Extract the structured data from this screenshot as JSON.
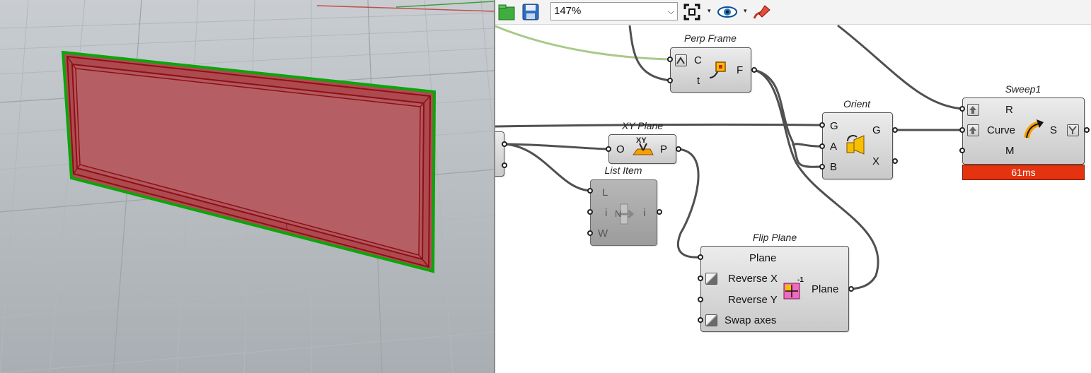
{
  "toolbar": {
    "zoom_value": "147%",
    "icons": [
      "open-file-icon",
      "save-file-icon",
      "zoom-extents-icon",
      "preview-eye-icon",
      "sketch-pen-icon"
    ]
  },
  "viewport": {
    "colors": {
      "fill": "#b55459",
      "edge": "#8e0f15",
      "selection": "#0aa60a",
      "background": "#b4b8bc"
    }
  },
  "components": {
    "perp_frame": {
      "title": "Perp Frame",
      "inputs": [
        "C",
        "t"
      ],
      "outputs": [
        "F"
      ]
    },
    "orient": {
      "title": "Orient",
      "inputs": [
        "G",
        "A",
        "B"
      ],
      "outputs": [
        "G",
        "X"
      ]
    },
    "sweep1": {
      "title": "Sweep1",
      "inputs": [
        "R",
        "Curve",
        "M"
      ],
      "outputs": [
        "S"
      ],
      "timing": "61ms"
    },
    "xy_plane": {
      "title": "XY Plane",
      "inputs": [
        "O"
      ],
      "outputs": [
        "P"
      ],
      "icon_text": "XY"
    },
    "list_item": {
      "title": "List Item",
      "inputs": [
        "L",
        "i",
        "W"
      ],
      "outputs": [
        "i"
      ],
      "icon_text": "N"
    },
    "flip_plane": {
      "title": "Flip Plane",
      "inputs": [
        "Plane",
        "Reverse X",
        "Reverse Y",
        "Swap axes"
      ],
      "outputs": [
        "Plane"
      ],
      "icon_text": "-1"
    }
  },
  "colors": {
    "timing_bg": "#e4330e",
    "wire": "#505050",
    "selected_wire": "#aac98a"
  }
}
